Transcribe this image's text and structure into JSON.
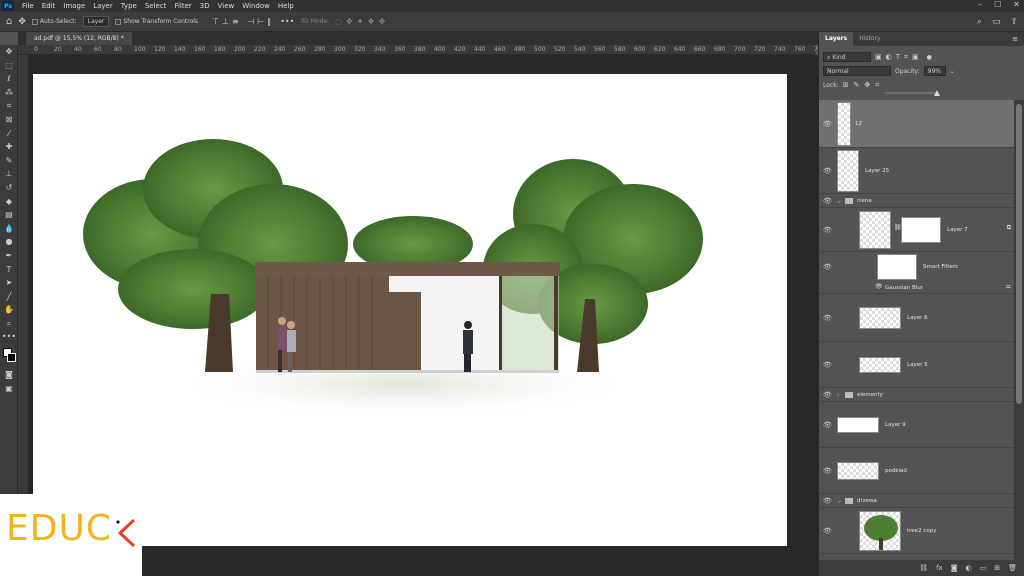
{
  "menu": [
    "File",
    "Edit",
    "Image",
    "Layer",
    "Type",
    "Select",
    "Filter",
    "3D",
    "View",
    "Window",
    "Help"
  ],
  "options": {
    "auto_select": "Auto-Select:",
    "auto_select_value": "Layer",
    "transform": "Show Transform Controls",
    "mode_3d": "3D Mode:"
  },
  "document_tab": "ad.pdf @ 15,5% (12, RGB/8) *",
  "ruler_ticks": [
    "0",
    "20",
    "40",
    "60",
    "80",
    "100",
    "120",
    "140",
    "160",
    "180",
    "200",
    "220",
    "240",
    "260",
    "280",
    "300",
    "320",
    "340",
    "360",
    "380",
    "400",
    "420",
    "440",
    "460",
    "480",
    "500",
    "520",
    "540",
    "560",
    "580",
    "600",
    "620",
    "640",
    "660",
    "680",
    "700",
    "720",
    "740",
    "760",
    "780"
  ],
  "panel": {
    "tabs": [
      "Layers",
      "History"
    ],
    "filter_kind": "Kind",
    "blend_mode": "Normal",
    "opacity_label": "Opacity:",
    "opacity_value": "99%",
    "lock_label": "Lock:",
    "layers": [
      {
        "name": "12",
        "type": "layer",
        "active": true
      },
      {
        "name": "Layer 25",
        "type": "layer"
      },
      {
        "name": "ciena",
        "type": "group"
      },
      {
        "name": "Layer 7",
        "type": "layer-mask"
      },
      {
        "name": "Smart Filters",
        "type": "smart-filter"
      },
      {
        "name": "Gaussian Blur",
        "type": "filter"
      },
      {
        "name": "Layer 6",
        "type": "layer"
      },
      {
        "name": "Layer 5",
        "type": "layer"
      },
      {
        "name": "elementy",
        "type": "group"
      },
      {
        "name": "Layer 9",
        "type": "layer"
      },
      {
        "name": "podklad",
        "type": "layer"
      },
      {
        "name": "drzewa",
        "type": "group"
      },
      {
        "name": "tree2 copy",
        "type": "layer"
      }
    ]
  },
  "logo": {
    "text": "EDUC",
    "accent_color": "#e8401c",
    "text_color": "#f1b21c"
  },
  "colors": {
    "app_bg": "#535353",
    "menu_bg": "#323232",
    "canvas_bg": "#282828",
    "tree_green": "#5a8a3a"
  }
}
